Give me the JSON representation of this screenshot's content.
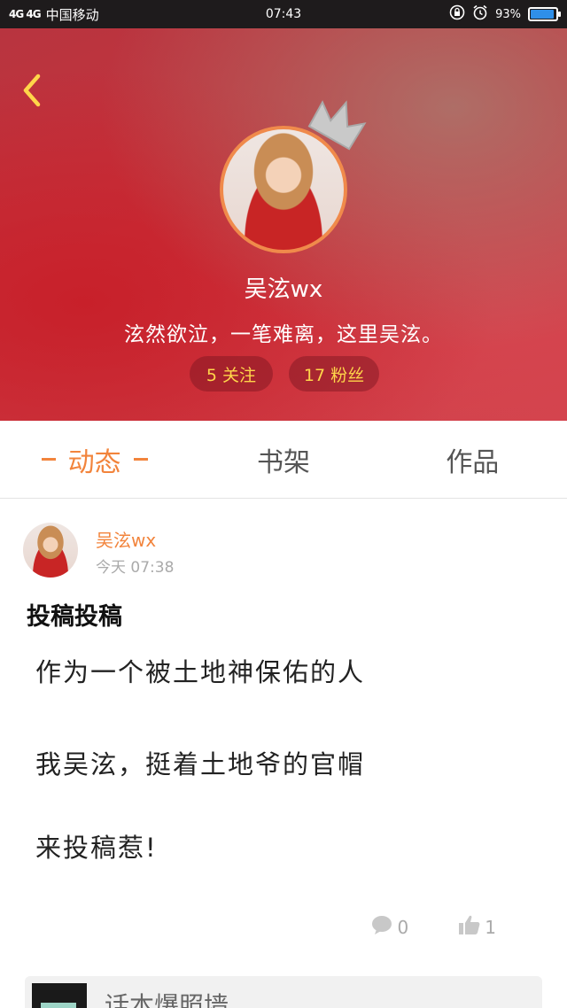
{
  "status_bar": {
    "network": "4G 4G",
    "carrier": "中国移动",
    "time": "07:43",
    "battery_text": "93%",
    "battery_level": 0.93,
    "battery_color": "#2f8fe8"
  },
  "header": {
    "back_icon": "chevron-left-icon",
    "crown_icon": "crown-icon",
    "nickname": "吴泫wx",
    "motto": "泫然欲泣，一笔难离，这里吴泫。",
    "following": "5 关注",
    "followers": "17 粉丝",
    "accent": "#ffd54a"
  },
  "tabs": [
    {
      "label": "动态",
      "active": true
    },
    {
      "label": "书架",
      "active": false
    },
    {
      "label": "作品",
      "active": false
    }
  ],
  "post": {
    "author": "吴泫wx",
    "time": "今天 07:38",
    "title": "投稿投稿",
    "lines": [
      "作为一个被土地神保佑的人",
      "我吴泫，挺着土地爷的官帽",
      "来投稿惹!"
    ],
    "comments": "0",
    "likes": "1",
    "quote_title": "话本爆照墙"
  },
  "colors": {
    "accent_orange": "#f2843c",
    "header_red": "#c8323c"
  }
}
